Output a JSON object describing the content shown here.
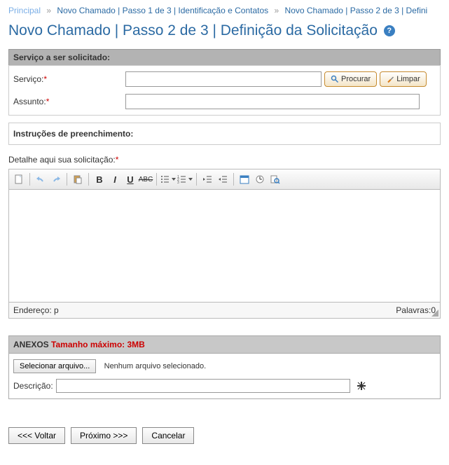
{
  "breadcrumb": {
    "items": [
      {
        "label": "Principal"
      },
      {
        "label": "Novo Chamado | Passo 1 de 3 | Identificação e Contatos"
      },
      {
        "label": "Novo Chamado | Passo 2 de 3 | Defini"
      }
    ],
    "sep": "»"
  },
  "page_title": "Novo Chamado | Passo 2 de 3 | Definição da Solicitação",
  "help_icon_label": "?",
  "service_section": {
    "header": "Serviço a ser solicitado:",
    "servico_label": "Serviço:",
    "assunto_label": "Assunto:",
    "procurar_btn": "Procurar",
    "limpar_btn": "Limpar",
    "servico_value": "",
    "assunto_value": ""
  },
  "instructions_label": "Instruções de preenchimento:",
  "detail_label": "Detalhe aqui sua solicitação:",
  "editor": {
    "path_label": "Endereço:",
    "path_value": "p",
    "word_label": "Palavras:",
    "word_count": "0"
  },
  "attachments": {
    "title": "ANEXOS",
    "max": "Tamanho máximo: 3MB",
    "choose_btn": "Selecionar arquivo...",
    "no_file": "Nenhum arquivo selecionado.",
    "desc_label": "Descrição:",
    "desc_value": ""
  },
  "buttons": {
    "back": "<<< Voltar",
    "next": "Próximo >>>",
    "cancel": "Cancelar"
  }
}
